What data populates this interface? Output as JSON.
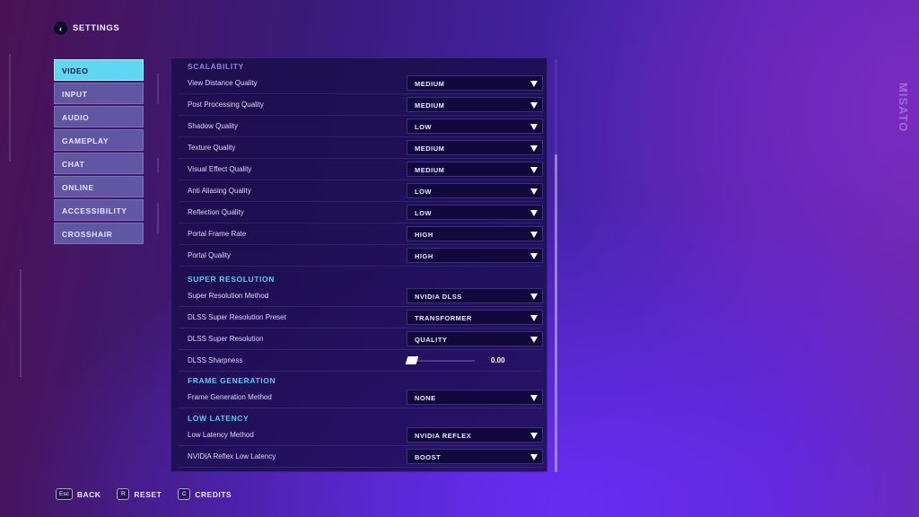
{
  "header": {
    "back_icon": "chevron-left-icon",
    "title": "SETTINGS"
  },
  "tabs": [
    {
      "label": "VIDEO",
      "active": true
    },
    {
      "label": "INPUT",
      "active": false
    },
    {
      "label": "AUDIO",
      "active": false
    },
    {
      "label": "GAMEPLAY",
      "active": false
    },
    {
      "label": "CHAT",
      "active": false
    },
    {
      "label": "ONLINE",
      "active": false
    },
    {
      "label": "ACCESSIBILITY",
      "active": false
    },
    {
      "label": "CROSSHAIR",
      "active": false
    }
  ],
  "decor": {
    "brand_right": "MISATO"
  },
  "sections": {
    "scalability": {
      "title": "SCALABILITY",
      "rows": [
        {
          "label": "View Distance Quality",
          "value": "MEDIUM"
        },
        {
          "label": "Post Processing Quality",
          "value": "MEDIUM"
        },
        {
          "label": "Shadow Quality",
          "value": "LOW"
        },
        {
          "label": "Texture Quality",
          "value": "MEDIUM"
        },
        {
          "label": "Visual Effect Quality",
          "value": "MEDIUM"
        },
        {
          "label": "Anti Aliasing Quality",
          "value": "LOW"
        },
        {
          "label": "Reflection Quality",
          "value": "LOW"
        },
        {
          "label": "Portal Frame Rate",
          "value": "HIGH"
        },
        {
          "label": "Portal Quality",
          "value": "HIGH"
        }
      ]
    },
    "super_resolution": {
      "title": "SUPER RESOLUTION",
      "rows": [
        {
          "label": "Super Resolution Method",
          "value": "NVIDIA DLSS"
        },
        {
          "label": "DLSS Super Resolution Preset",
          "value": "TRANSFORMER"
        },
        {
          "label": "DLSS Super Resolution",
          "value": "QUALITY"
        }
      ],
      "sharpness": {
        "label": "DLSS Sharpness",
        "value": "0.00"
      }
    },
    "frame_generation": {
      "title": "FRAME GENERATION",
      "rows": [
        {
          "label": "Frame Generation Method",
          "value": "NONE"
        }
      ]
    },
    "low_latency": {
      "title": "LOW LATENCY",
      "rows": [
        {
          "label": "Low Latency Method",
          "value": "NVIDIA REFLEX"
        },
        {
          "label": "NVIDIA Reflex Low Latency",
          "value": "BOOST"
        }
      ]
    }
  },
  "footer": [
    {
      "key": "Esc",
      "label": "BACK"
    },
    {
      "key": "R",
      "label": "RESET"
    },
    {
      "key": "C",
      "label": "CREDITS"
    }
  ]
}
